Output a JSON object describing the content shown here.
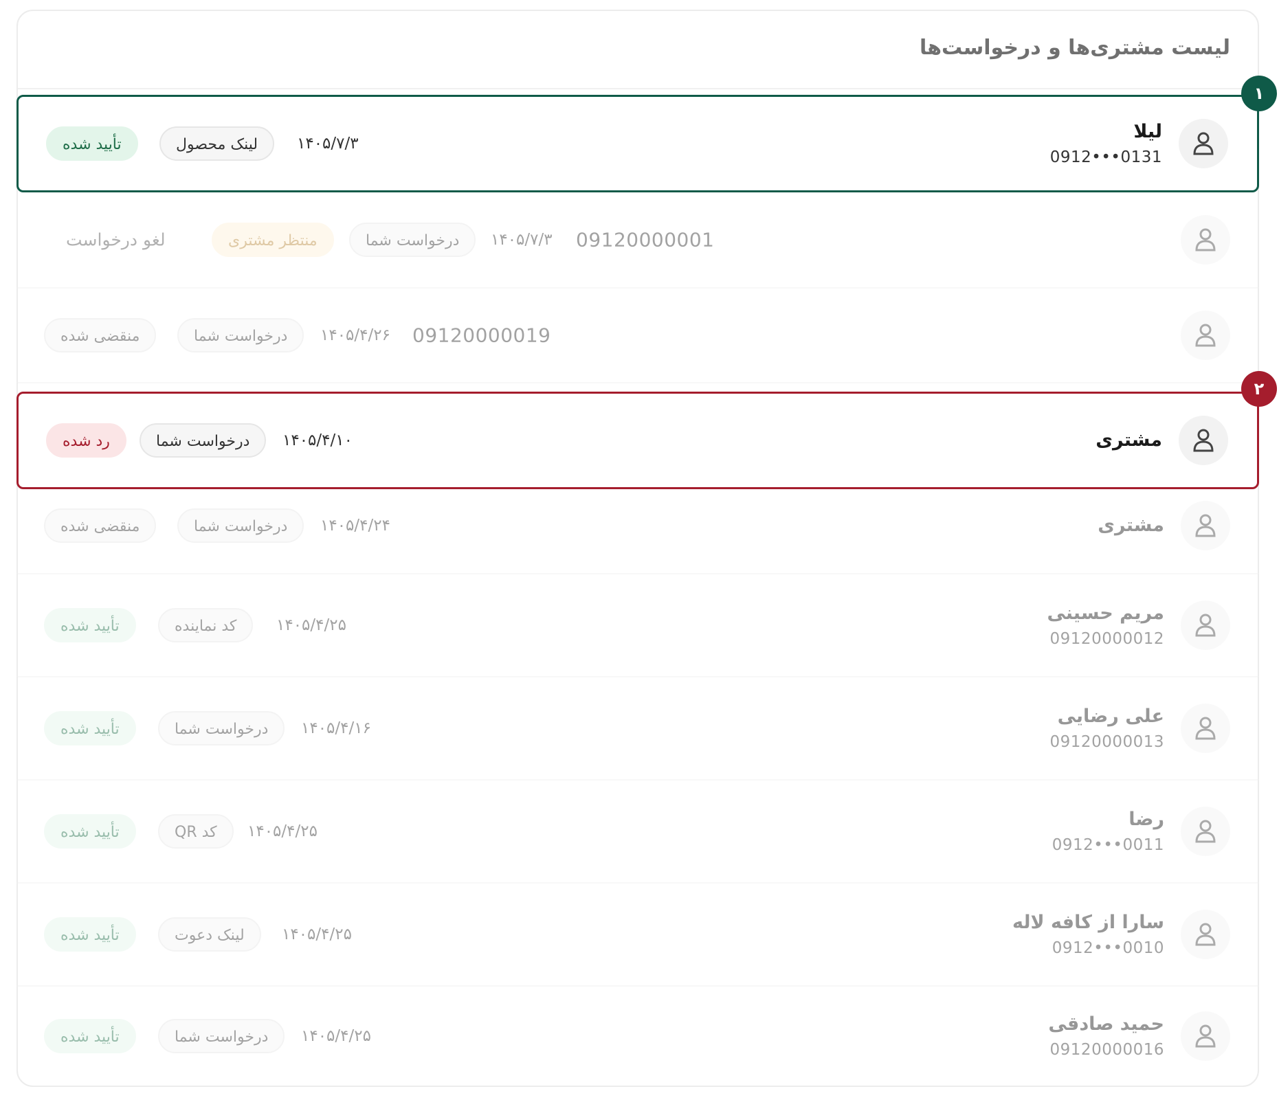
{
  "page_title": "لیست مشتری‌ها و درخواست‌ها",
  "markers": [
    "۱",
    "۲"
  ],
  "rows": [
    {
      "name": "لیلا",
      "phone": "0912•••0131",
      "date": "۱۴۰۵/۷/۳",
      "source": "لینک محصول",
      "status": "تأیید شده",
      "status_type": "green"
    },
    {
      "phone": "09120000001",
      "date": "۱۴۰۵/۷/۳",
      "source": "درخواست شما",
      "status": "منتظر مشتری",
      "status_type": "orange",
      "action": "لغو درخواست"
    },
    {
      "phone": "09120000019",
      "date": "۱۴۰۵/۴/۲۶",
      "source": "درخواست شما",
      "status": "منقضی شده",
      "status_type": "neutral"
    },
    {
      "name": "مشتری",
      "date": "۱۴۰۵/۴/۱۰",
      "source": "درخواست شما",
      "status": "رد شده",
      "status_type": "red"
    },
    {
      "name": "مشتری",
      "date": "۱۴۰۵/۴/۲۴",
      "source": "درخواست شما",
      "status": "منقضی شده",
      "status_type": "neutral"
    },
    {
      "name": "مریم حسینی",
      "phone": "09120000012",
      "date": "۱۴۰۵/۴/۲۵",
      "source": "کد نماینده",
      "status": "تأیید شده",
      "status_type": "green"
    },
    {
      "name": "علی رضایی",
      "phone": "09120000013",
      "date": "۱۴۰۵/۴/۱۶",
      "source": "درخواست شما",
      "status": "تأیید شده",
      "status_type": "green"
    },
    {
      "name": "رضا",
      "phone": "0912•••0011",
      "date": "۱۴۰۵/۴/۲۵",
      "source": "کد QR",
      "status": "تأیید شده",
      "status_type": "green"
    },
    {
      "name": "سارا از کافه لاله",
      "phone": "0912•••0010",
      "date": "۱۴۰۵/۴/۲۵",
      "source": "لینک دعوت",
      "status": "تأیید شده",
      "status_type": "green"
    },
    {
      "name": "حمید صادقی",
      "phone": "09120000016",
      "date": "۱۴۰۵/۴/۲۵",
      "source": "درخواست شما",
      "status": "تأیید شده",
      "status_type": "green"
    }
  ]
}
